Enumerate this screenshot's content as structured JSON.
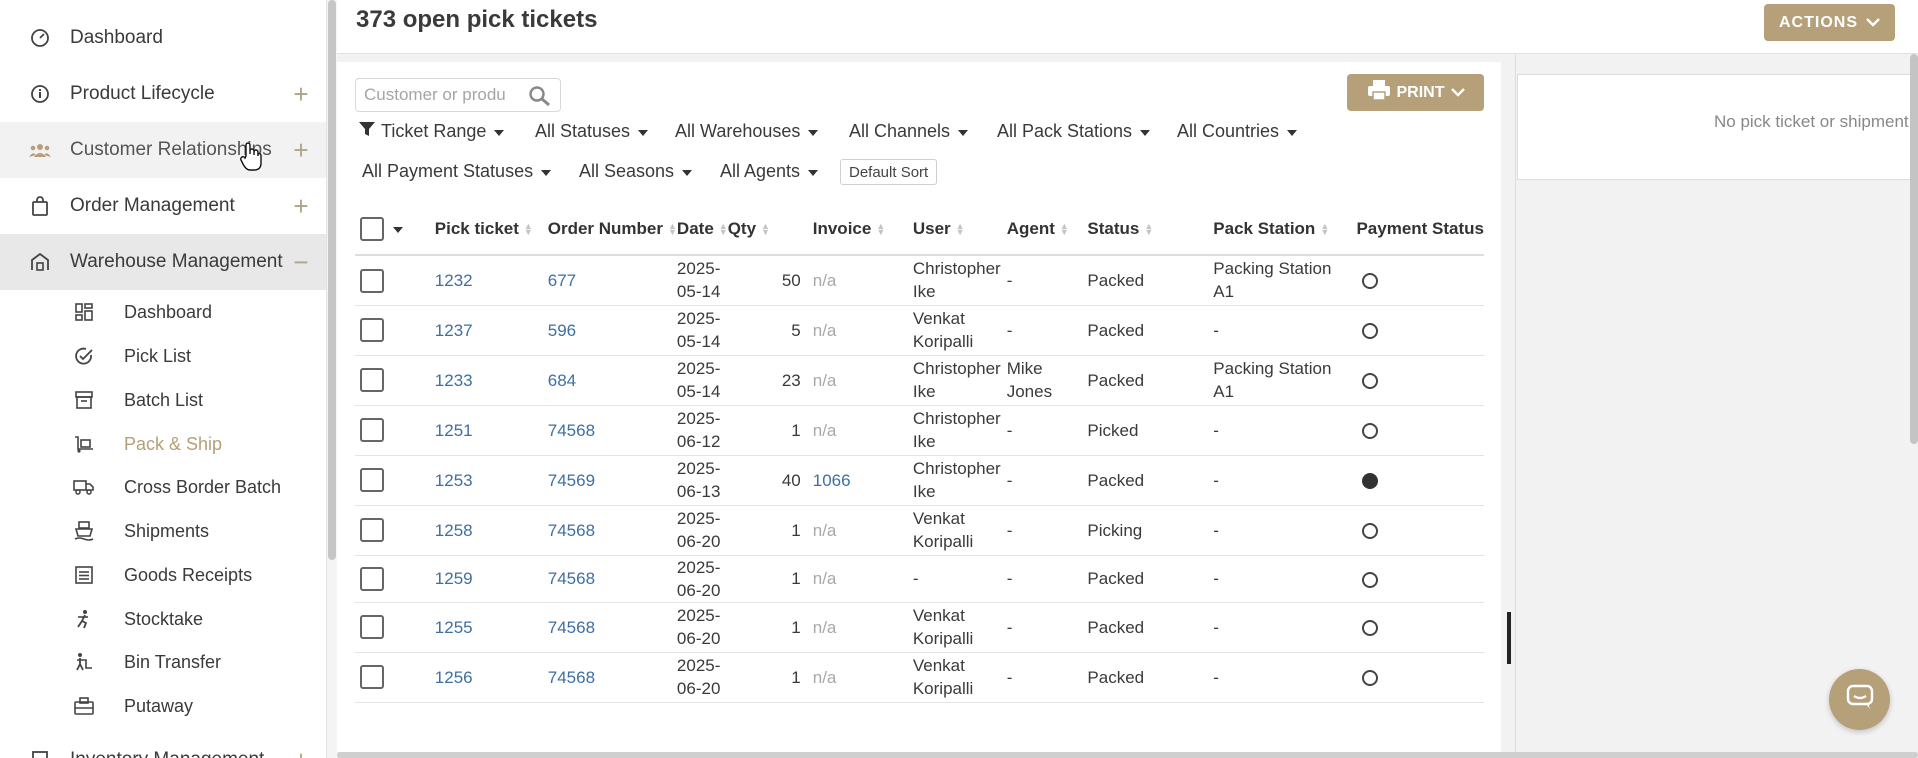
{
  "sidebar": {
    "items": [
      {
        "label": "Dashboard",
        "icon": "gauge-icon"
      },
      {
        "label": "Product Lifecycle",
        "icon": "info-icon",
        "action": "+"
      },
      {
        "label": "Customer Relationships",
        "icon": "users-icon",
        "action": "+"
      },
      {
        "label": "Order Management",
        "icon": "shopping-bag-icon",
        "action": "+"
      },
      {
        "label": "Warehouse Management",
        "icon": "warehouse-icon",
        "action": "−"
      }
    ],
    "sub_items": [
      {
        "label": "Dashboard",
        "icon": "grid-icon"
      },
      {
        "label": "Pick List",
        "icon": "check-circle-icon"
      },
      {
        "label": "Batch List",
        "icon": "archive-icon"
      },
      {
        "label": "Pack & Ship",
        "icon": "dolly-icon"
      },
      {
        "label": "Cross Border Batch",
        "icon": "truck-icon"
      },
      {
        "label": "Shipments",
        "icon": "shipment-icon"
      },
      {
        "label": "Goods Receipts",
        "icon": "receipt-icon"
      },
      {
        "label": "Stocktake",
        "icon": "stocktake-icon"
      },
      {
        "label": "Bin Transfer",
        "icon": "forklift-icon"
      },
      {
        "label": "Putaway",
        "icon": "putaway-icon"
      }
    ],
    "partial_item": "Inventory Management"
  },
  "header": {
    "title": "373 open pick tickets",
    "actions_label": "ACTIONS"
  },
  "toolbar": {
    "search_placeholder": "Customer or produ",
    "print_label": "PRINT",
    "filters_row1": [
      "Ticket Range",
      "All Statuses",
      "All Warehouses",
      "All Channels",
      "All Pack Stations",
      "All Countries"
    ],
    "filters_row2": [
      "All Payment Statuses",
      "All Seasons",
      "All Agents"
    ],
    "default_sort": "Default Sort"
  },
  "table": {
    "columns": [
      "Pick ticket",
      "Order Number",
      "Date",
      "Qty",
      "Invoice",
      "User",
      "Agent",
      "Status",
      "Pack Station",
      "Payment Status"
    ],
    "rows": [
      {
        "ticket": "1232",
        "order": "677",
        "date": "2025-05-14",
        "qty": "50",
        "invoice": "n/a",
        "user": "Christopher Ike",
        "agent": "-",
        "status": "Packed",
        "station": "Packing Station A1",
        "paid": false
      },
      {
        "ticket": "1237",
        "order": "596",
        "date": "2025-05-14",
        "qty": "5",
        "invoice": "n/a",
        "user": "Venkat Koripalli",
        "agent": "-",
        "status": "Packed",
        "station": "-",
        "paid": false
      },
      {
        "ticket": "1233",
        "order": "684",
        "date": "2025-05-14",
        "qty": "23",
        "invoice": "n/a",
        "user": "Christopher Ike",
        "agent": "Mike Jones",
        "status": "Packed",
        "station": "Packing Station A1",
        "paid": false
      },
      {
        "ticket": "1251",
        "order": "74568",
        "date": "2025-06-12",
        "qty": "1",
        "invoice": "n/a",
        "user": "Christopher Ike",
        "agent": "-",
        "status": "Picked",
        "station": "-",
        "paid": false
      },
      {
        "ticket": "1253",
        "order": "74569",
        "date": "2025-06-13",
        "qty": "40",
        "invoice": "1066",
        "user": "Christopher Ike",
        "agent": "-",
        "status": "Packed",
        "station": "-",
        "paid": true
      },
      {
        "ticket": "1258",
        "order": "74568",
        "date": "2025-06-20",
        "qty": "1",
        "invoice": "n/a",
        "user": "Venkat Koripalli",
        "agent": "-",
        "status": "Picking",
        "station": "-",
        "paid": false
      },
      {
        "ticket": "1259",
        "order": "74568",
        "date": "2025-06-20",
        "qty": "1",
        "invoice": "n/a",
        "user": "-",
        "agent": "-",
        "status": "Packed",
        "station": "-",
        "paid": false
      },
      {
        "ticket": "1255",
        "order": "74568",
        "date": "2025-06-20",
        "qty": "1",
        "invoice": "n/a",
        "user": "Venkat Koripalli",
        "agent": "-",
        "status": "Packed",
        "station": "-",
        "paid": false
      },
      {
        "ticket": "1256",
        "order": "74568",
        "date": "2025-06-20",
        "qty": "1",
        "invoice": "n/a",
        "user": "Venkat Koripalli",
        "agent": "-",
        "status": "Packed",
        "station": "-",
        "paid": false
      }
    ]
  },
  "side_panel": {
    "empty_text": "No pick ticket or shipment"
  },
  "colors": {
    "accent": "#b5a07a",
    "link": "#3e6fa3",
    "active_nav_text": "#b49f78"
  }
}
